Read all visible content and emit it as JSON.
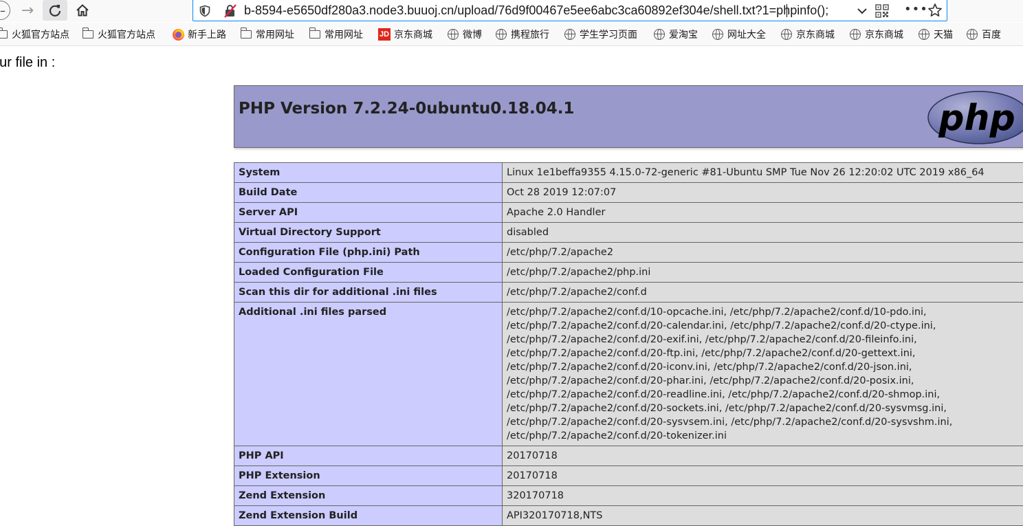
{
  "browser": {
    "url": "b-8594-e5650df280a3.node3.buuoj.cn/upload/76d9f00467e5ee6abc3ca60892ef304e/shell.txt?1=phpinfo();",
    "more_label": "•••"
  },
  "bookmarks": [
    {
      "label": "火狐官方站点",
      "icon": "folder-icon"
    },
    {
      "label": "火狐官方站点",
      "icon": "folder-icon"
    },
    {
      "label": "新手上路",
      "icon": "firefox-icon"
    },
    {
      "label": "常用网址",
      "icon": "folder-icon"
    },
    {
      "label": "常用网址",
      "icon": "folder-icon"
    },
    {
      "label": "京东商城",
      "icon": "jd-icon"
    },
    {
      "label": "微博",
      "icon": "globe-icon"
    },
    {
      "label": "携程旅行",
      "icon": "globe-icon"
    },
    {
      "label": "学生学习页面",
      "icon": "globe-icon"
    },
    {
      "label": "爱淘宝",
      "icon": "globe-icon"
    },
    {
      "label": "网址大全",
      "icon": "globe-icon"
    },
    {
      "label": "京东商城",
      "icon": "globe-icon"
    },
    {
      "label": "京东商城",
      "icon": "globe-icon"
    },
    {
      "label": "天猫",
      "icon": "globe-icon"
    },
    {
      "label": "百度",
      "icon": "globe-icon"
    }
  ],
  "page": {
    "upload_message": "our file in :",
    "php_version_title": "PHP Version 7.2.24-0ubuntu0.18.04.1",
    "logo_text": "php",
    "colors": {
      "header_bg": "#9999cc",
      "key_bg": "#ccccff",
      "value_bg": "#dddddd"
    },
    "rows": [
      {
        "key": "System",
        "value": "Linux 1e1beffa9355 4.15.0-72-generic #81-Ubuntu SMP Tue Nov 26 12:20:02 UTC 2019 x86_64"
      },
      {
        "key": "Build Date",
        "value": "Oct 28 2019 12:07:07"
      },
      {
        "key": "Server API",
        "value": "Apache 2.0 Handler"
      },
      {
        "key": "Virtual Directory Support",
        "value": "disabled"
      },
      {
        "key": "Configuration File (php.ini) Path",
        "value": "/etc/php/7.2/apache2"
      },
      {
        "key": "Loaded Configuration File",
        "value": "/etc/php/7.2/apache2/php.ini"
      },
      {
        "key": "Scan this dir for additional .ini files",
        "value": "/etc/php/7.2/apache2/conf.d"
      },
      {
        "key": "Additional .ini files parsed",
        "value": "/etc/php/7.2/apache2/conf.d/10-opcache.ini, /etc/php/7.2/apache2/conf.d/10-pdo.ini, /etc/php/7.2/apache2/conf.d/20-calendar.ini, /etc/php/7.2/apache2/conf.d/20-ctype.ini, /etc/php/7.2/apache2/conf.d/20-exif.ini, /etc/php/7.2/apache2/conf.d/20-fileinfo.ini, /etc/php/7.2/apache2/conf.d/20-ftp.ini, /etc/php/7.2/apache2/conf.d/20-gettext.ini, /etc/php/7.2/apache2/conf.d/20-iconv.ini, /etc/php/7.2/apache2/conf.d/20-json.ini, /etc/php/7.2/apache2/conf.d/20-phar.ini, /etc/php/7.2/apache2/conf.d/20-posix.ini, /etc/php/7.2/apache2/conf.d/20-readline.ini, /etc/php/7.2/apache2/conf.d/20-shmop.ini, /etc/php/7.2/apache2/conf.d/20-sockets.ini, /etc/php/7.2/apache2/conf.d/20-sysvmsg.ini, /etc/php/7.2/apache2/conf.d/20-sysvsem.ini, /etc/php/7.2/apache2/conf.d/20-sysvshm.ini, /etc/php/7.2/apache2/conf.d/20-tokenizer.ini"
      },
      {
        "key": "PHP API",
        "value": "20170718"
      },
      {
        "key": "PHP Extension",
        "value": "20170718"
      },
      {
        "key": "Zend Extension",
        "value": "320170718"
      },
      {
        "key": "Zend Extension Build",
        "value": "API320170718,NTS"
      }
    ]
  }
}
